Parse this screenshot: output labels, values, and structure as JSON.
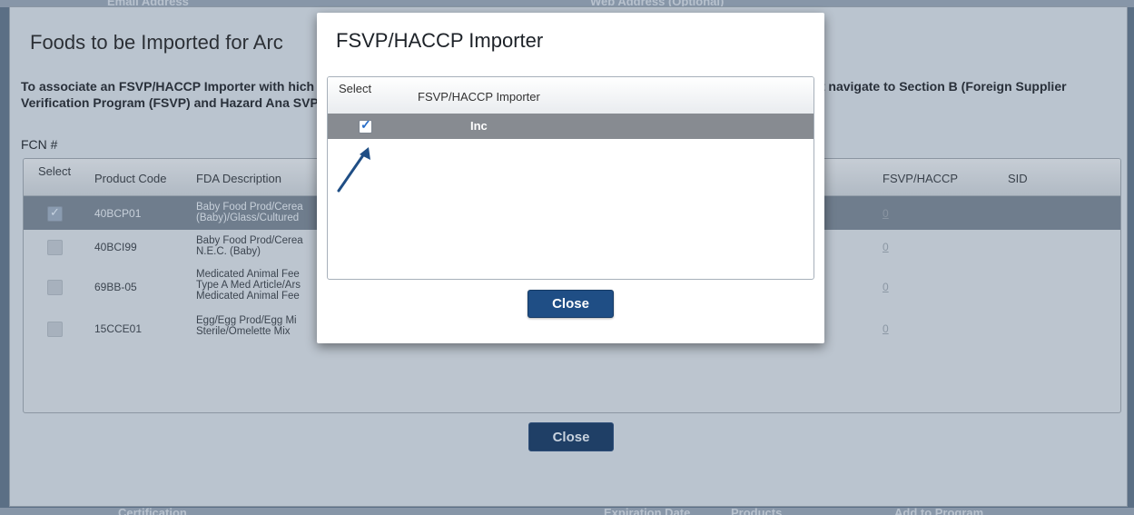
{
  "background": {
    "top_left_label": "Email Address",
    "top_right_label": "Web Address (Optional)",
    "bottom_labels": [
      "Certification",
      "Expiration Date",
      "Products",
      "Add to Program"
    ]
  },
  "outer_modal": {
    "title": "Foods to be Imported for Arc",
    "description": "To associate an FSVP/HACCP Importer with                                                                                                                                              hich corresponds to the desired product. The system will provide a pop-up allowing y                                                                                                                                    rst navigate to Section B (Foreign Supplier Verification Program (FSVP) and Hazard Ana                                                                                                                        SVP or HACCP importer.",
    "fcn_label": "FCN #",
    "table": {
      "columns": [
        "Select",
        "Product Code",
        "FDA Description",
        "FSVP/HACCP",
        "SID"
      ],
      "rows": [
        {
          "selected": true,
          "code": "40BCP01",
          "desc_line1": "Baby Food Prod/Cerea",
          "desc_line2": "(Baby)/Glass/Cultured",
          "desc_line3": "",
          "fsvp": "0"
        },
        {
          "selected": false,
          "code": "40BCI99",
          "desc_line1": "Baby Food Prod/Cerea",
          "desc_line2": "N.E.C. (Baby)",
          "desc_line3": "",
          "fsvp": "0"
        },
        {
          "selected": false,
          "code": "69BB-05",
          "desc_line1": "Medicated Animal Fee",
          "desc_line2": "Type A Med Article/Ars",
          "desc_line3": "Medicated Animal Fee",
          "fsvp": "0"
        },
        {
          "selected": false,
          "code": "15CCE01",
          "desc_line1": "Egg/Egg Prod/Egg Mi",
          "desc_line2": "Sterile/Omelette Mix",
          "desc_line3": "",
          "fsvp": "0"
        }
      ]
    },
    "close_label": "Close"
  },
  "dialog": {
    "title": "FSVP/HACCP Importer",
    "table": {
      "columns": [
        "Select",
        "FSVP/HACCP Importer"
      ],
      "rows": [
        {
          "selected": true,
          "name": "Inc"
        }
      ]
    },
    "close_label": "Close"
  },
  "colors": {
    "button_primary": "#1f4e85",
    "selected_row": "#878b91",
    "checkmark": "#2a6fc9",
    "arrow": "#1f4e85"
  }
}
